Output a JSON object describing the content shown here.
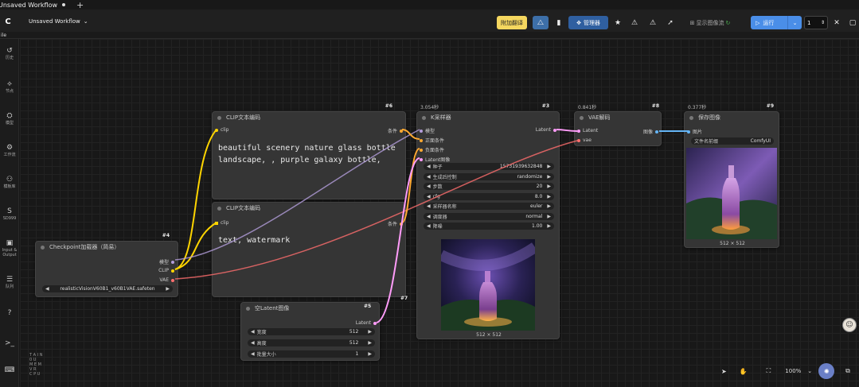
{
  "tabs": [
    {
      "label": "Unsaved Workflow",
      "modified": true
    }
  ],
  "workflow_title": "Unsaved Workflow",
  "toolbar": {
    "translate_label": "附加翻译",
    "manager_label": "管理器",
    "run_label": "运行",
    "queue_count": "1",
    "show_image_label": "显示图像流"
  },
  "status_line": "ile",
  "sidebar": [
    {
      "icon": "history-icon",
      "glyph": "↺",
      "label": "历史"
    },
    {
      "icon": "nodes-icon",
      "glyph": "⟡",
      "label": "节点"
    },
    {
      "icon": "model-icon",
      "glyph": "⛭",
      "label": "模型"
    },
    {
      "icon": "workflow-icon",
      "glyph": "⚙",
      "label": "工作流"
    },
    {
      "icon": "template-icon",
      "glyph": "⚇",
      "label": "模板库"
    },
    {
      "icon": "sd-icon",
      "glyph": "S",
      "label": "SD999"
    },
    {
      "icon": "image-output-icon",
      "glyph": "▣",
      "label": "Input & Output"
    },
    {
      "icon": "queue-icon",
      "glyph": "☰",
      "label": "队列"
    },
    {
      "icon": "help-icon",
      "glyph": "?",
      "label": ""
    },
    {
      "icon": "terminal-icon",
      "glyph": ">_",
      "label": ""
    },
    {
      "icon": "keyboard-icon",
      "glyph": "⌨",
      "label": ""
    }
  ],
  "sysinfo": [
    "T A I N",
    "0 U",
    "M E M",
    "V R",
    "C P U"
  ],
  "nodes": {
    "checkpoint": {
      "id": "#4",
      "title": "Checkpoint加载器（简易）",
      "outputs": [
        "模型",
        "CLIP",
        "VAE"
      ],
      "widget": "realisticVisionV60B1_v60B1VAE.safeten"
    },
    "clip_pos": {
      "id": "#6",
      "title": "CLIP文本编码",
      "input": "clip",
      "output": "条件",
      "text": "beautiful scenery nature glass bottle landscape, , purple galaxy bottle,"
    },
    "clip_neg": {
      "id": "#7",
      "title": "CLIP文本编码",
      "input": "clip",
      "output": "条件",
      "text": "text, watermark"
    },
    "latent": {
      "id": "#5",
      "title": "空Latent图像",
      "output": "Latent",
      "widgets": [
        {
          "label": "宽度",
          "value": "512"
        },
        {
          "label": "高度",
          "value": "512"
        },
        {
          "label": "批量大小",
          "value": "1"
        }
      ]
    },
    "ksampler": {
      "id": "#3",
      "time": "3.054秒",
      "title": "K采样器",
      "inputs": [
        "模型",
        "正面条件",
        "负面条件",
        "Latent图像"
      ],
      "output": "Latent",
      "widgets": [
        {
          "label": "种子",
          "value": "15731939632848"
        },
        {
          "label": "生成后控制",
          "value": "randomize"
        },
        {
          "label": "步数",
          "value": "20"
        },
        {
          "label": "cfg",
          "value": "8.0"
        },
        {
          "label": "采样器名称",
          "value": "euler"
        },
        {
          "label": "调度器",
          "value": "normal"
        },
        {
          "label": "降噪",
          "value": "1.00"
        }
      ],
      "caption": "512 × 512"
    },
    "vae": {
      "id": "#8",
      "time": "0.841秒",
      "title": "VAE解码",
      "inputs": [
        "Latent",
        "vae"
      ],
      "output": "图像"
    },
    "save": {
      "id": "#9",
      "time": "0.377秒",
      "title": "保存图像",
      "input": "图片",
      "widget_label": "文件名前缀",
      "widget_value": "ComfyUI",
      "caption": "512 × 512"
    }
  },
  "bottom": {
    "zoom": "100%"
  },
  "colors": {
    "accent": "#4a8ee8",
    "clip_wire": "#ffd500",
    "model_wire": "#b39ddb",
    "vae_wire": "#ff6e6e",
    "latent_wire": "#ff9cf9",
    "cond_wire": "#ffa931",
    "image_wire": "#64b5f6"
  }
}
